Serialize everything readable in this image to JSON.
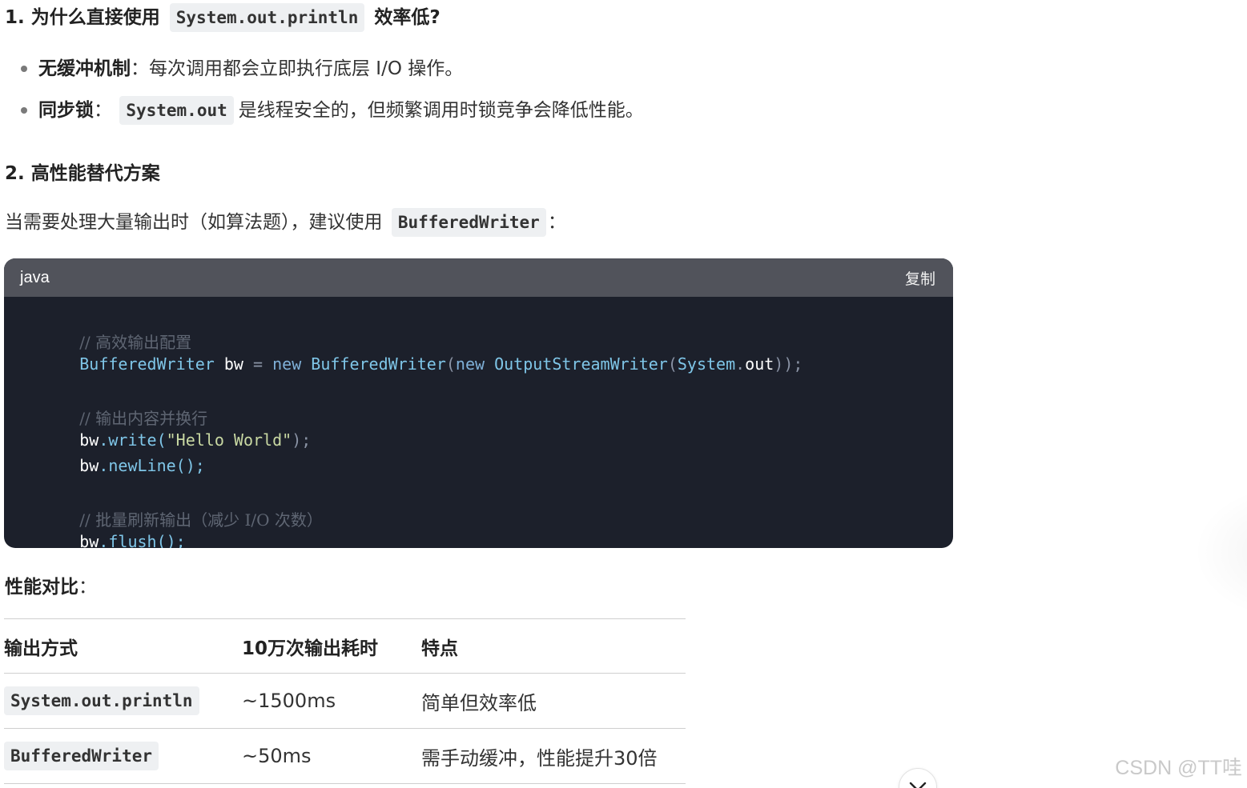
{
  "section1": {
    "heading_prefix": "1. 为什么直接使用",
    "heading_code": "System.out.println",
    "heading_suffix": "效率低?"
  },
  "bullets": [
    {
      "bold": "无缓冲机制",
      "sep": "：",
      "text": "每次调用都会立即执行底层 I/O 操作。"
    },
    {
      "bold": "同步锁",
      "sep": "：",
      "code": "System.out",
      "text": "是线程安全的，但频繁调用时锁竞争会降低性能。"
    }
  ],
  "section2": {
    "heading": "2. 高性能替代方案"
  },
  "intro": {
    "text": "当需要处理大量输出时（如算法题），建议使用",
    "code": "BufferedWriter",
    "suffix": "："
  },
  "code_block": {
    "language": "java",
    "copy_label": "复制",
    "lines": {
      "c1": "// 高效输出配置",
      "l2_type": "BufferedWriter",
      "l2_var": "bw",
      "l2_eq": "=",
      "l2_new1": "new",
      "l2_cls1": "BufferedWriter",
      "l2_p1": "(",
      "l2_new2": "new",
      "l2_cls2": "OutputStreamWriter",
      "l2_p2": "(",
      "l2_sys": "System",
      "l2_dot": ".",
      "l2_out": "out",
      "l2_end": "));",
      "c2": "// 输出内容并换行",
      "l5_var": "bw",
      "l5_method": ".write(",
      "l5_str": "\"Hello World\"",
      "l5_end": ");",
      "l6_var": "bw",
      "l6_method": ".newLine();",
      "c3": "// 批量刷新输出（减少 I/O 次数）",
      "l9_var": "bw",
      "l9_method": ".flush();"
    }
  },
  "compare": {
    "label": "性能对比",
    "sep": "："
  },
  "table": {
    "headers": [
      "输出方式",
      "10万次输出耗时",
      "特点"
    ],
    "rows": [
      {
        "method": "System.out.println",
        "time": "~1500ms",
        "feature": "简单但效率低"
      },
      {
        "method": "BufferedWriter",
        "time": "~50ms",
        "feature": "需手动缓冲，性能提升30倍"
      }
    ]
  },
  "watermark": "CSDN @TT哇",
  "icons": {
    "scroll_down": "chevron-down-icon"
  }
}
